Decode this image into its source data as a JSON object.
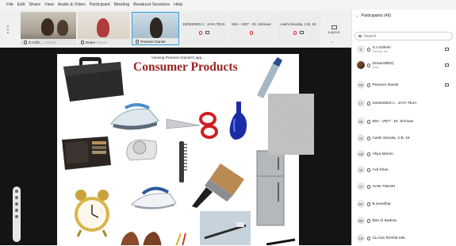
{
  "menu": [
    "File",
    "Edit",
    "Share",
    "View",
    "Audio & Video",
    "Participant",
    "Meeting",
    "Breakout Sessions",
    "Help"
  ],
  "video_tiles": [
    {
      "name": "S.V.Sh...",
      "extra": "Cohost..."
    },
    {
      "name": "Deam",
      "extra": "Deam..."
    },
    {
      "name": "Praveen Daniel"
    }
  ],
  "name_tiles": [
    {
      "name": "190340003 A . JAYA TEJA"
    },
    {
      "name": "594 - VIET - Dr. Srinivas"
    },
    {
      "name": "Aashi Sisodia, 2-B, 18"
    }
  ],
  "layout_label": "Layout",
  "share_note": "Viewing Praveen Daniel's app...",
  "slide_title": "Consumer Products",
  "panel": {
    "title": "Participants (49)",
    "search_placeholder": "Search",
    "participants": [
      {
        "initials": "S",
        "name": "S.V.Srilesh",
        "sub": "Cohost, me",
        "video": true
      },
      {
        "initials": "",
        "name": "Dream09b0)",
        "sub": "Host",
        "video": true,
        "photo": true
      },
      {
        "initials": "PD",
        "name": "Praveen Daniel",
        "sub": "",
        "video": true
      },
      {
        "initials": "1T",
        "name": "190340003 A . JAYA TEJA",
        "sub": ""
      },
      {
        "initials": "5S",
        "name": "594 - VIET - Dr. Srinivas",
        "sub": ""
      },
      {
        "initials": "A1",
        "name": "Aashi Sisodia, 2-B, 18",
        "sub": ""
      },
      {
        "initials": "AM",
        "name": "Afiya Momin",
        "sub": ""
      },
      {
        "initials": "AK",
        "name": "Avil Khan",
        "sub": ""
      },
      {
        "initials": "AT",
        "name": "AVIN TIWARI",
        "sub": ""
      },
      {
        "initials": "BS",
        "name": "B sreedhar",
        "sub": ""
      },
      {
        "initials": "BB",
        "name": "Ban Al Badran",
        "sub": ""
      },
      {
        "initials": "CO",
        "name": "CLASS ROOM 035",
        "sub": ""
      }
    ]
  }
}
